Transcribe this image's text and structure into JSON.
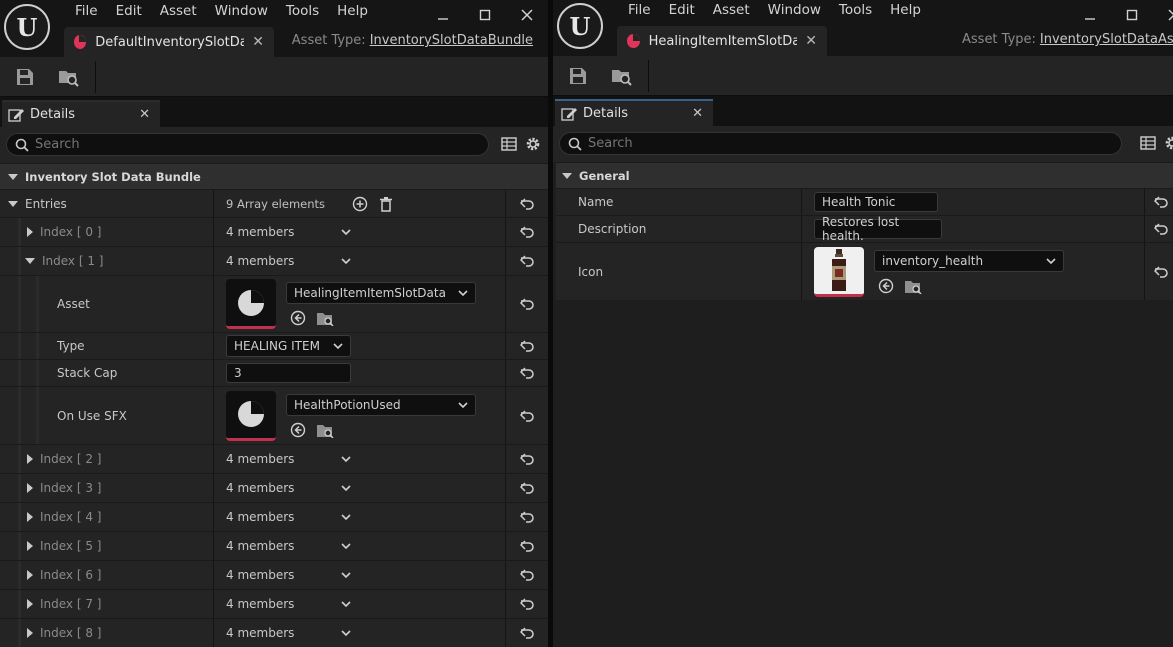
{
  "left": {
    "menu": [
      "File",
      "Edit",
      "Asset",
      "Window",
      "Tools",
      "Help"
    ],
    "tab_label": "DefaultInventorySlotDat...",
    "asset_type_label": "Asset Type:",
    "asset_type_value": "InventorySlotDataBundle",
    "details_tab": "Details",
    "search_placeholder": "Search",
    "category": "Inventory Slot Data Bundle",
    "entries_label": "Entries",
    "entries_value": "9 Array elements",
    "index_rows": [
      {
        "label": "Index [ 0 ]",
        "value": "4 members"
      },
      {
        "label": "Index [ 1 ]",
        "value": "4 members"
      },
      {
        "label": "Index [ 2 ]",
        "value": "4 members"
      },
      {
        "label": "Index [ 3 ]",
        "value": "4 members"
      },
      {
        "label": "Index [ 4 ]",
        "value": "4 members"
      },
      {
        "label": "Index [ 5 ]",
        "value": "4 members"
      },
      {
        "label": "Index [ 6 ]",
        "value": "4 members"
      },
      {
        "label": "Index [ 7 ]",
        "value": "4 members"
      },
      {
        "label": "Index [ 8 ]",
        "value": "4 members"
      }
    ],
    "expanded": {
      "asset_label": "Asset",
      "asset_value": "HealingItemItemSlotData",
      "type_label": "Type",
      "type_value": "HEALING ITEM",
      "stack_label": "Stack Cap",
      "stack_value": "3",
      "sfx_label": "On Use SFX",
      "sfx_value": "HealthPotionUsed"
    }
  },
  "right": {
    "menu": [
      "File",
      "Edit",
      "Asset",
      "Window",
      "Tools",
      "Help"
    ],
    "tab_label": "HealingItemItemSlotData",
    "asset_type_label": "Asset Type:",
    "asset_type_value": "InventorySlotDataAsset",
    "details_tab": "Details",
    "search_placeholder": "Search",
    "category": "General",
    "name_label": "Name",
    "name_value": "Health Tonic",
    "description_label": "Description",
    "description_value": "Restores lost health.",
    "icon_label": "Icon",
    "icon_value": "inventory_health"
  },
  "logo_letter": "U",
  "colors": {
    "accent": "#c2304d",
    "asset_glyph": "#e0345a",
    "panel": "#242424",
    "background": "#151515"
  }
}
